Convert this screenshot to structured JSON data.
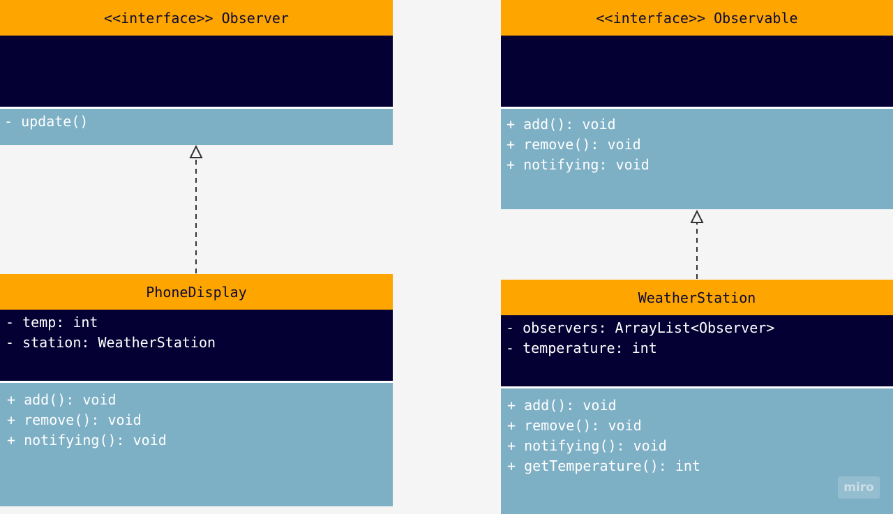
{
  "classes": {
    "observer": {
      "name": "<<interface>> Observer",
      "attributes": [],
      "methods": [
        "- update()"
      ]
    },
    "observable": {
      "name": "<<interface>> Observable",
      "attributes": [],
      "methods": [
        "+ add(): void",
        "+ remove(): void",
        "+ notifying: void"
      ]
    },
    "phonedisplay": {
      "name": "PhoneDisplay",
      "attributes": [
        "- temp: int",
        "- station: WeatherStation"
      ],
      "methods": [
        "+ add(): void",
        "+ remove(): void",
        "+ notifying(): void"
      ]
    },
    "weatherstation": {
      "name": "WeatherStation",
      "attributes": [
        "- observers: ArrayList<Observer>",
        "- temperature: int"
      ],
      "methods": [
        "+ add(): void",
        "+ remove(): void",
        "+ notifying(): void",
        "+ getTemperature(): int"
      ]
    }
  },
  "relations": [
    {
      "from": "PhoneDisplay",
      "to": "<<interface>> Observer",
      "type": "realization"
    },
    {
      "from": "WeatherStation",
      "to": "<<interface>> Observable",
      "type": "realization"
    }
  ],
  "watermark": "miro",
  "colors": {
    "header": "#ffa500",
    "attributes_bg": "#050033",
    "methods_bg": "#7dafc5",
    "canvas_bg": "#f5f5f5"
  }
}
